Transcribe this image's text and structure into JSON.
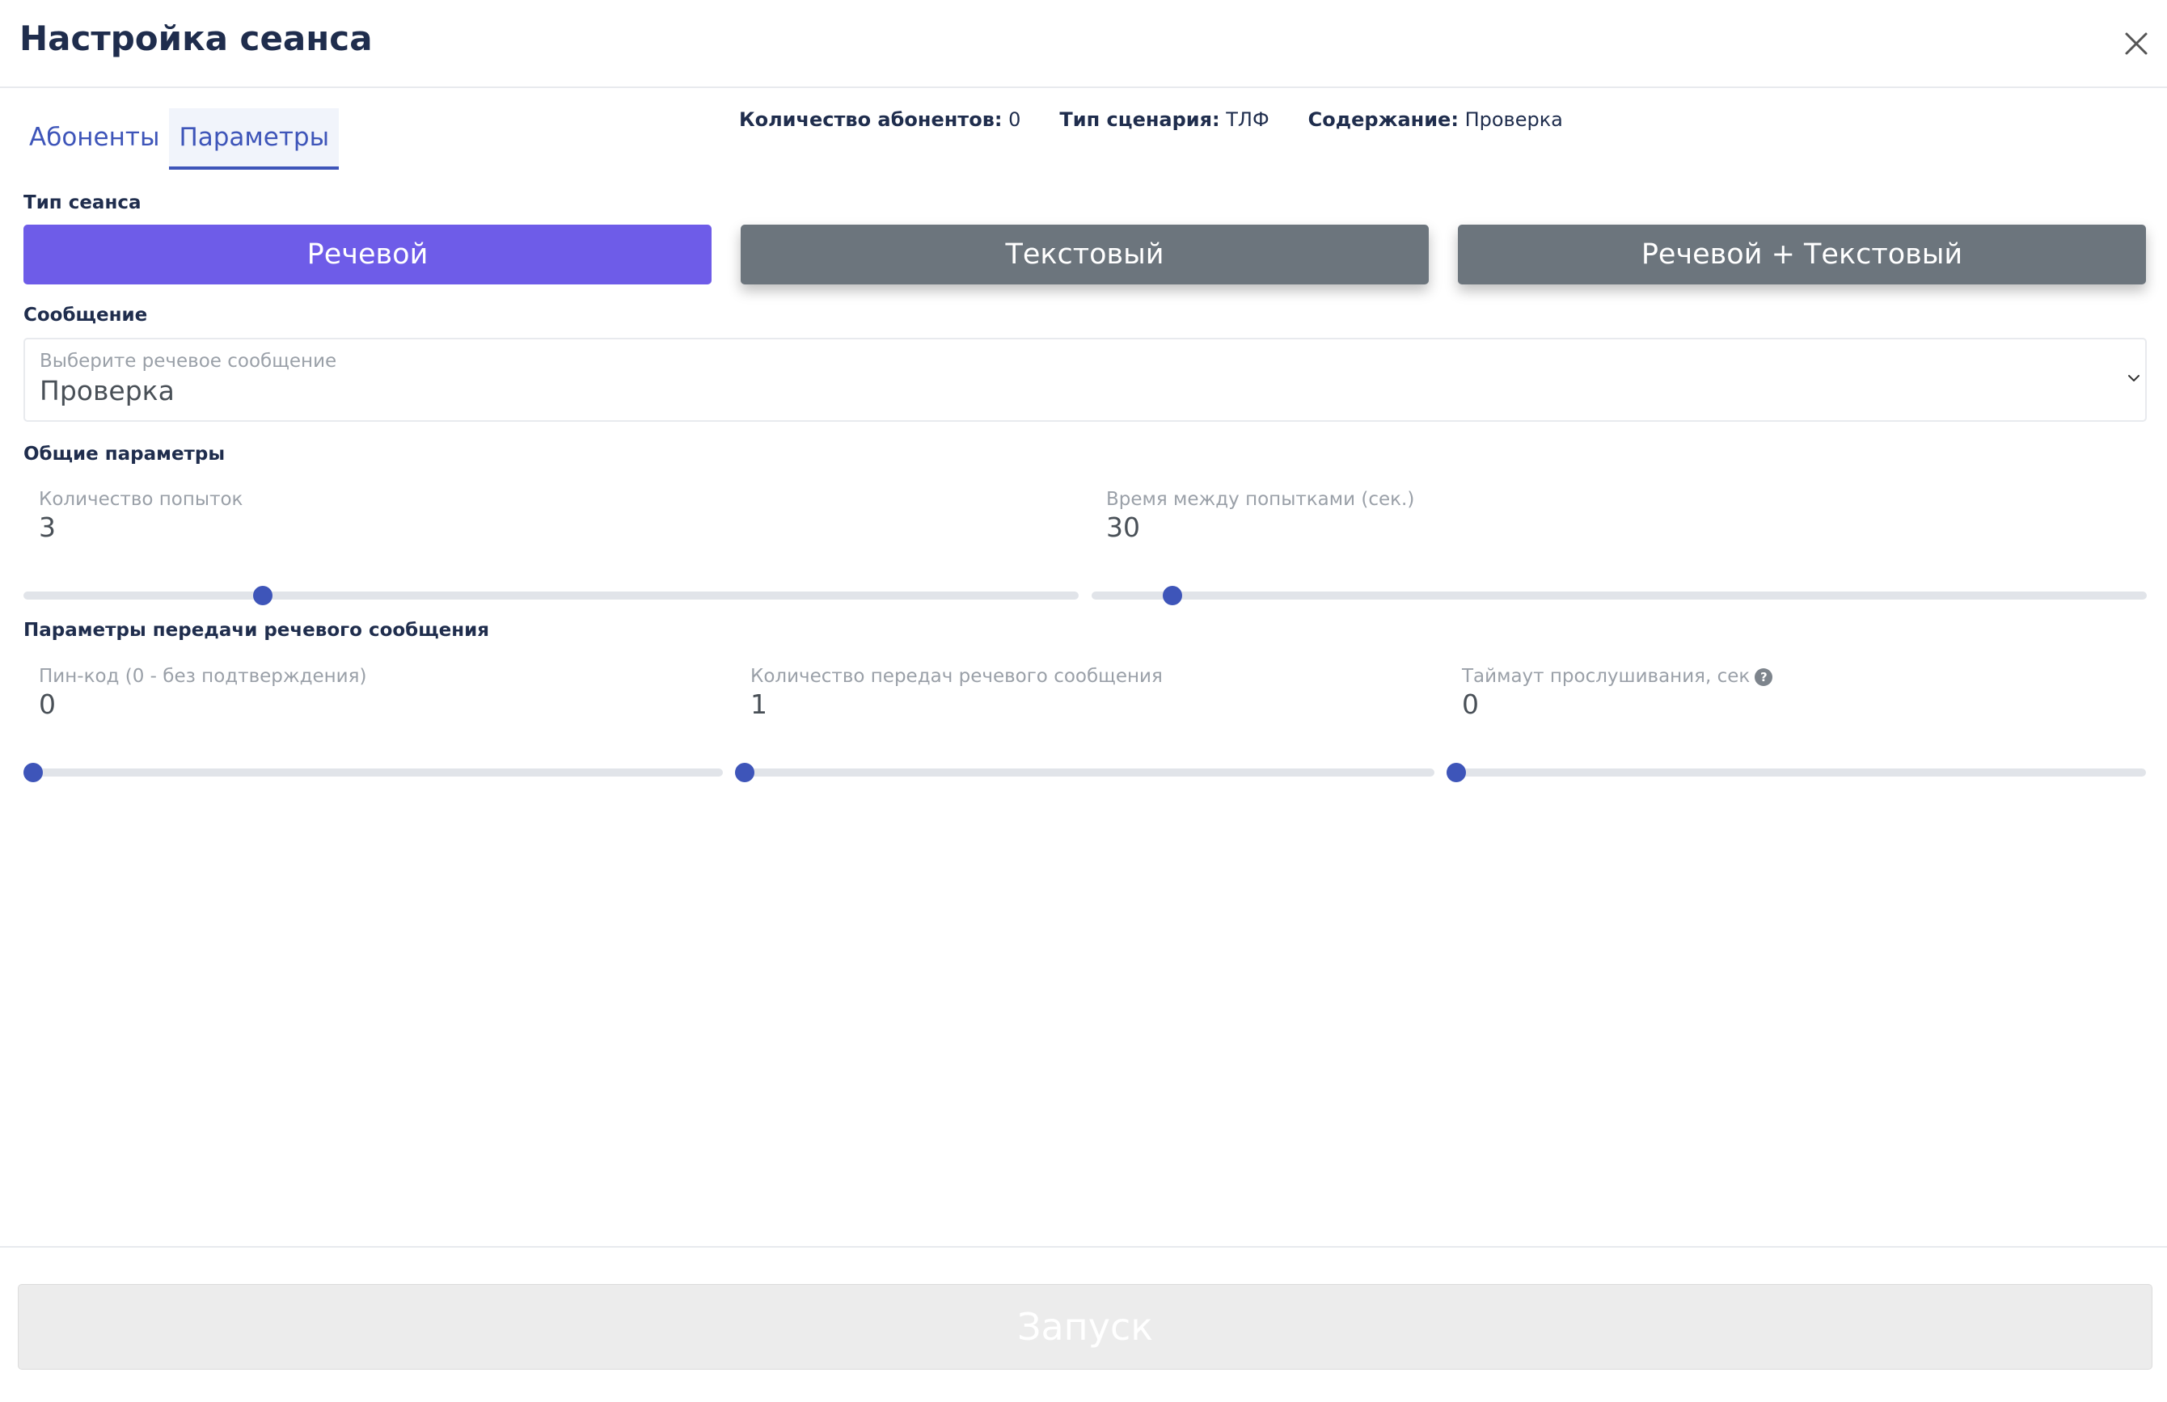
{
  "dialog": {
    "title": "Настройка сеанса"
  },
  "tabs": [
    {
      "label": "Абоненты",
      "active": false
    },
    {
      "label": "Параметры",
      "active": true
    }
  ],
  "summary": {
    "subscribers_label": "Количество абонентов:",
    "subscribers_value": "0",
    "scenario_label": "Тип сценария:",
    "scenario_value": "ТЛФ",
    "content_label": "Содержание:",
    "content_value": "Проверка"
  },
  "session_type": {
    "label": "Тип сеанса",
    "options": [
      "Речевой",
      "Текстовый",
      "Речевой + Текстовый"
    ],
    "selected": "Речевой"
  },
  "message": {
    "label": "Сообщение",
    "placeholder": "Выберите речевое сообщение",
    "value": "Проверка"
  },
  "general_params": {
    "label": "Общие параметры",
    "attempts": {
      "label": "Количество попыток",
      "value": "3",
      "slider_fraction": 0.227
    },
    "interval": {
      "label": "Время между попытками (сек.)",
      "value": "30",
      "slider_fraction": 0.077
    }
  },
  "voice_params": {
    "label": "Параметры передачи речевого сообщения",
    "pin": {
      "label": "Пин-код (0 - без подтверждения)",
      "value": "0",
      "slider_fraction": 0
    },
    "repeats": {
      "label": "Количество передач речевого сообщения",
      "value": "1",
      "slider_fraction": 0
    },
    "timeout": {
      "label": "Таймаут прослушивания, сек",
      "value": "0",
      "slider_fraction": 0,
      "help": "?"
    }
  },
  "footer": {
    "launch_label": "Запуск",
    "enabled": false
  },
  "colors": {
    "accent": "#3e55b9",
    "active_type": "#6e5ce8",
    "inactive_type": "#6c757d",
    "title": "#1f2d4d"
  },
  "icons": {
    "close": "close-icon",
    "dropdown": "chevron-down-icon",
    "help": "question-circle-icon"
  }
}
